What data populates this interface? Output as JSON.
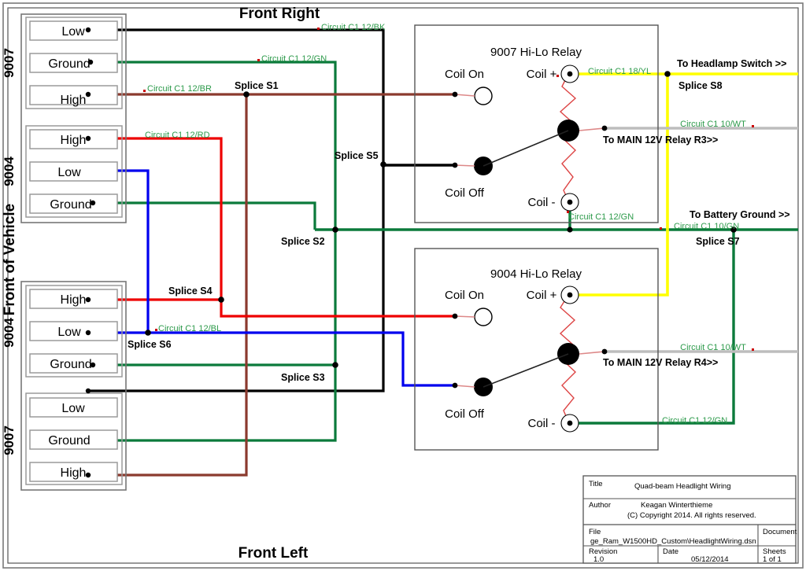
{
  "page": {
    "orientation_labels": {
      "front_right": "Front Right",
      "front_left": "Front Left",
      "front_of_vehicle": "Front of Vehicle"
    }
  },
  "connectors": [
    {
      "id": "fr-9007",
      "bulb": "9007",
      "pins": [
        {
          "label": "Low",
          "wire_color": "#000000"
        },
        {
          "label": "Ground",
          "wire_color": "#0b7a3b"
        },
        {
          "label": "High",
          "wire_color": "#8b3a2e"
        }
      ]
    },
    {
      "id": "fr-9004",
      "bulb": "9004",
      "pins": [
        {
          "label": "High",
          "wire_color": "#ee0000"
        },
        {
          "label": "Low",
          "wire_color": "#0000ee"
        },
        {
          "label": "Ground",
          "wire_color": "#0b7a3b"
        }
      ]
    },
    {
      "id": "fl-9004",
      "bulb": "9004",
      "pins": [
        {
          "label": "High",
          "wire_color": "#ee0000"
        },
        {
          "label": "Low",
          "wire_color": "#0000ee"
        },
        {
          "label": "Ground",
          "wire_color": "#0b7a3b"
        }
      ]
    },
    {
      "id": "fl-9007",
      "bulb": "9007",
      "pins": [
        {
          "label": "Low",
          "wire_color": "#000000"
        },
        {
          "label": "Ground",
          "wire_color": "#0b7a3b"
        },
        {
          "label": "High",
          "wire_color": "#8b3a2e"
        }
      ]
    }
  ],
  "relays": [
    {
      "id": "relay-9007",
      "title": "9007 Hi-Lo Relay",
      "terminals": {
        "coil_on": "Coil On",
        "coil_off": "Coil Off",
        "coil_plus": "Coil +",
        "coil_minus": "Coil -"
      }
    },
    {
      "id": "relay-9004",
      "title": "9004 Hi-Lo Relay",
      "terminals": {
        "coil_on": "Coil On",
        "coil_off": "Coil Off",
        "coil_plus": "Coil +",
        "coil_minus": "Coil -"
      }
    }
  ],
  "circuit_labels": [
    {
      "id": "c1-12-bk",
      "text": "Circuit C1 12/BK",
      "color": "#2c9a4a"
    },
    {
      "id": "c1-12-gn-top",
      "text": "Circuit C1 12/GN",
      "color": "#2c9a4a"
    },
    {
      "id": "c1-12-br",
      "text": "Circuit C1 12/BR",
      "color": "#2c9a4a"
    },
    {
      "id": "c1-12-rd",
      "text": "Circuit C1 12/RD",
      "color": "#2c9a4a"
    },
    {
      "id": "c1-12-bl",
      "text": "Circuit C1 12/BL",
      "color": "#2c9a4a"
    },
    {
      "id": "c1-18-yl",
      "text": "Circuit C1 18/YL",
      "color": "#2c9a4a"
    },
    {
      "id": "c1-10-wt-top",
      "text": "Circuit C1 10/WT",
      "color": "#2c9a4a"
    },
    {
      "id": "c1-10-wt-bottom",
      "text": "Circuit C1 10/WT",
      "color": "#2c9a4a"
    },
    {
      "id": "c1-12-gn-relay1",
      "text": "Circuit C1 12/GN",
      "color": "#2c9a4a"
    },
    {
      "id": "c1-12-gn-relay2",
      "text": "Circuit C1 12/GN",
      "color": "#2c9a4a"
    },
    {
      "id": "c1-10-gn",
      "text": "Circuit C1 10/GN",
      "color": "#2c9a4a"
    }
  ],
  "splices": [
    {
      "id": "s1",
      "label": "Splice S1"
    },
    {
      "id": "s2",
      "label": "Splice S2"
    },
    {
      "id": "s3",
      "label": "Splice S3"
    },
    {
      "id": "s4",
      "label": "Splice S4"
    },
    {
      "id": "s5",
      "label": "Splice S5"
    },
    {
      "id": "s6",
      "label": "Splice S6"
    },
    {
      "id": "s7",
      "label": "Splice S7"
    },
    {
      "id": "s8",
      "label": "Splice S8"
    }
  ],
  "destinations": [
    {
      "id": "headlamp-switch",
      "text": "To Headlamp Switch >>"
    },
    {
      "id": "main-12v-relay-r3",
      "text": "To MAIN 12V Relay R3>>"
    },
    {
      "id": "battery-ground",
      "text": "To Battery Ground >>"
    },
    {
      "id": "main-12v-relay-r4",
      "text": "To MAIN 12V Relay R4>>"
    }
  ],
  "title_block": {
    "title_label": "Title",
    "title_value": "Quad-beam Headlight Wiring",
    "author_label": "Author",
    "author_value": "Keagan Winterthieme",
    "copyright": "(C) Copyright 2014. All rights reserved.",
    "file_label": "File",
    "file_value": "ge_Ram_W1500HD_Custom\\HeadlightWiring.dsn",
    "document_label": "Document",
    "document_value": "",
    "revision_label": "Revision",
    "revision_value": "1.0",
    "date_label": "Date",
    "date_value": "05/12/2014",
    "sheets_label": "Sheets",
    "sheets_value": "1 of 1"
  },
  "colors": {
    "black": "#000000",
    "green": "#0b7a3b",
    "brown": "#8b3a2e",
    "red": "#ee0000",
    "blue": "#0000ee",
    "yellow": "#ffff00",
    "white_wire": "#bdbdbd",
    "label_green": "#2c9a4a",
    "frame": "#7a7a7a"
  }
}
